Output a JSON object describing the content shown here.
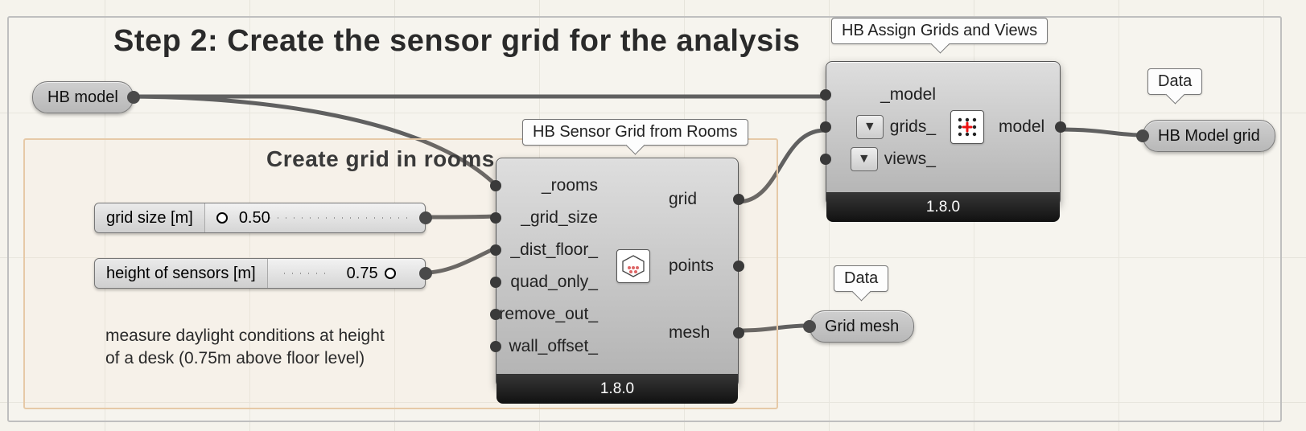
{
  "step_title": "Step 2: Create the sensor grid for the analysis",
  "group_inner_title": "Create grid in rooms",
  "note_desk": "measure daylight conditions at height\nof a desk (0.75m above floor level)",
  "hb_model_in": "HB model",
  "param_grid_size": {
    "label": "grid size [m]",
    "value": "0.50"
  },
  "param_height": {
    "label": "height of sensors [m]",
    "value": "0.75"
  },
  "sensor_grid": {
    "title": "HB Sensor Grid from Rooms",
    "inputs": [
      "_rooms",
      "_grid_size",
      "_dist_floor_",
      "quad_only_",
      "remove_out_",
      "wall_offset_"
    ],
    "outputs": [
      "grid",
      "points",
      "mesh"
    ],
    "version": "1.8.0"
  },
  "assign_grids": {
    "title": "HB Assign Grids and Views",
    "inputs": [
      "_model",
      "grids_",
      "views_"
    ],
    "outputs": [
      "model"
    ],
    "version": "1.8.0"
  },
  "grid_mesh": {
    "bubble": "Data",
    "label": "Grid mesh"
  },
  "model_out": {
    "bubble": "Data",
    "label": "HB Model grid"
  }
}
